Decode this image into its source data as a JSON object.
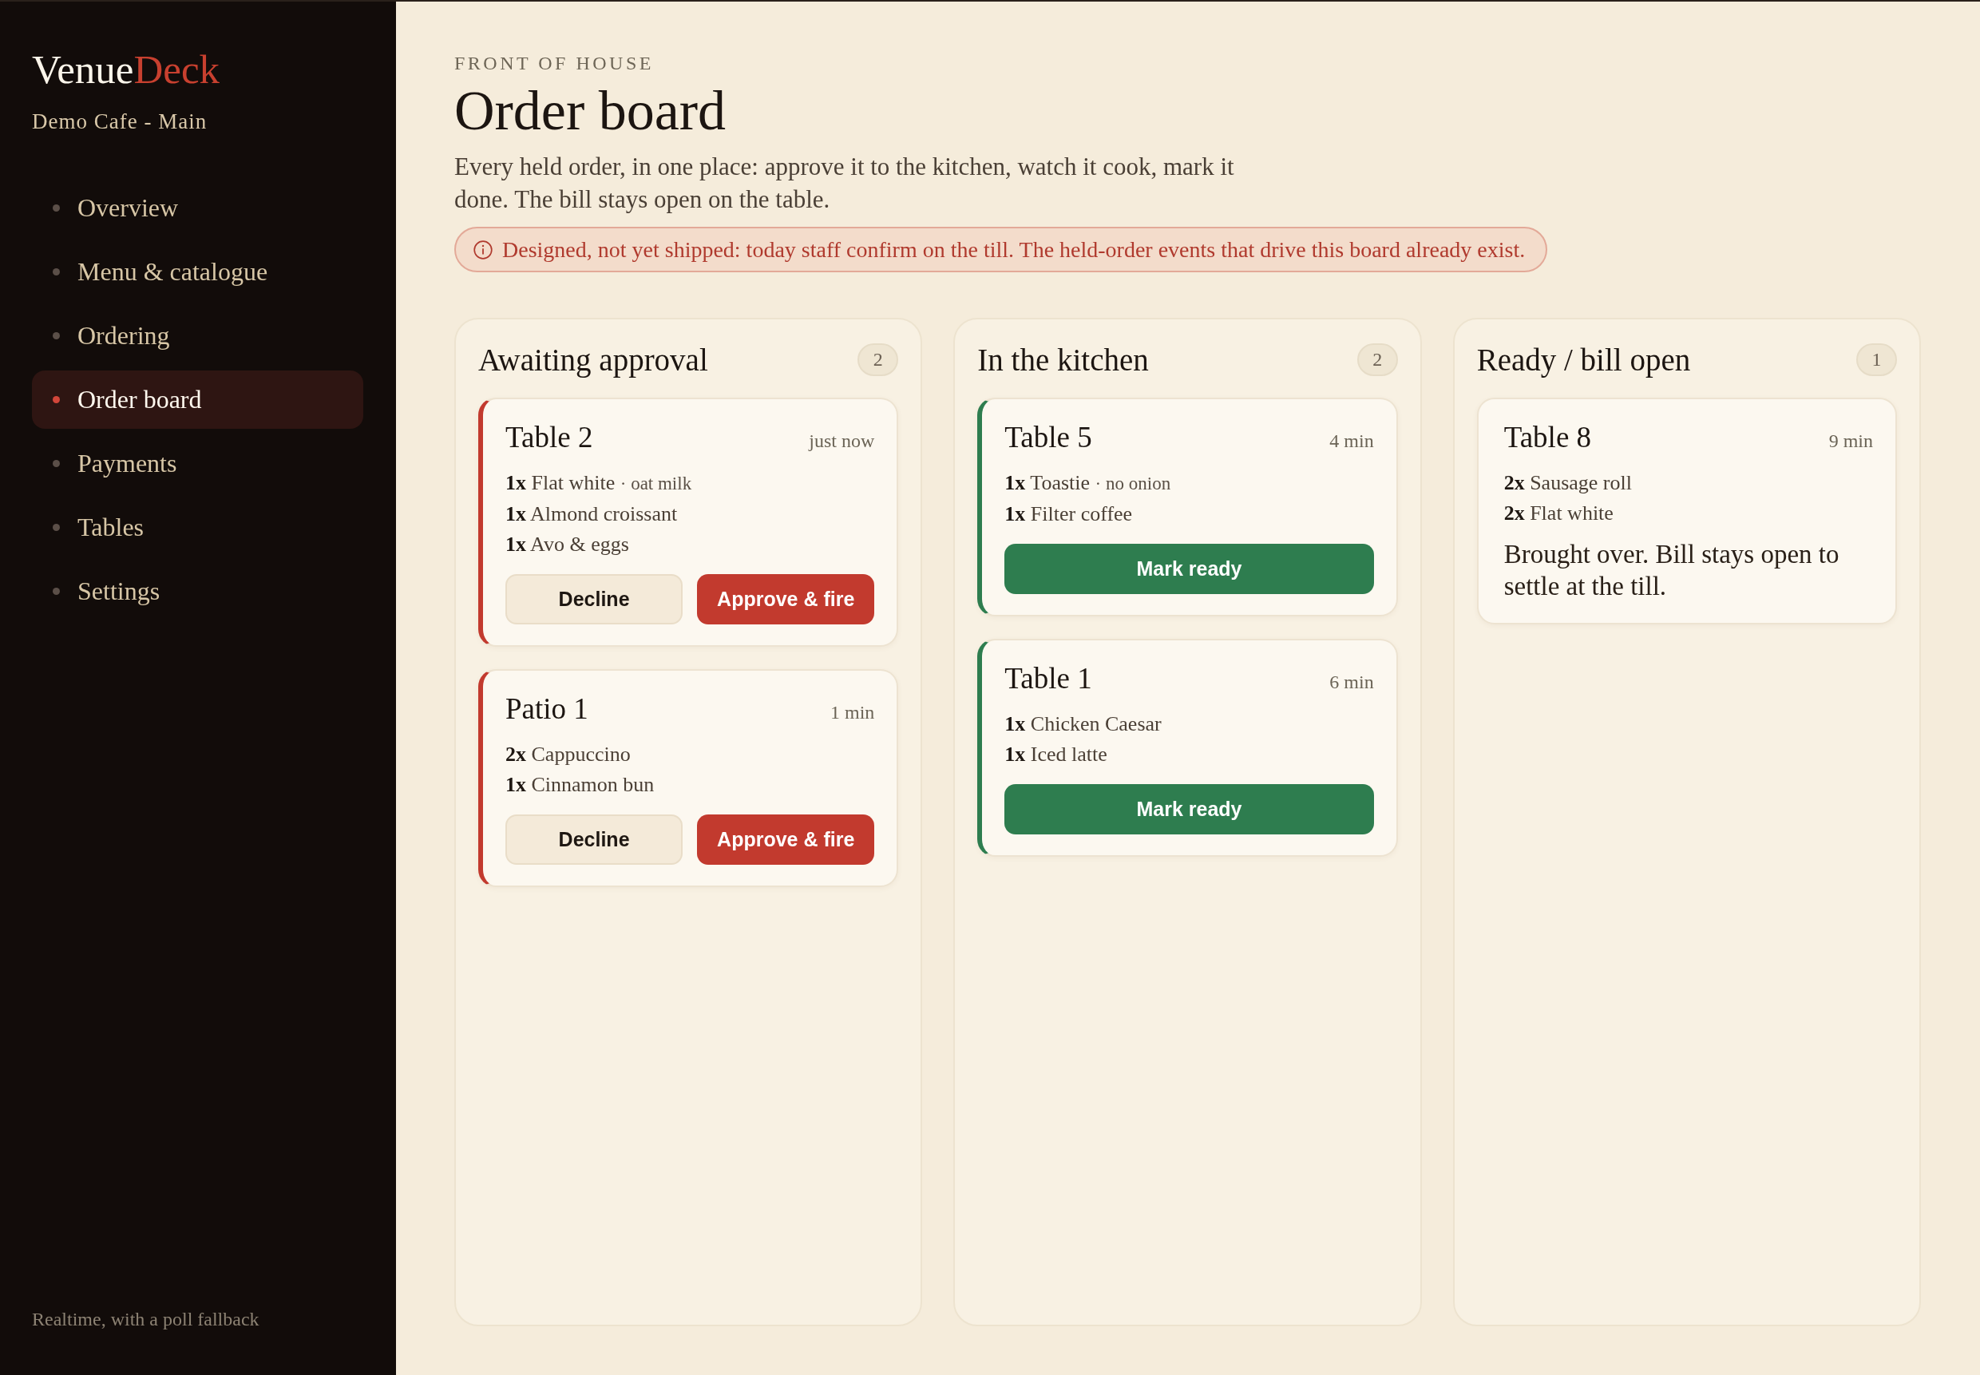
{
  "sidebar": {
    "brand": {
      "first": "Venue",
      "second": "Deck"
    },
    "venue": "Demo Cafe - Main",
    "nav": [
      {
        "label": "Overview",
        "selected": false
      },
      {
        "label": "Menu & catalogue",
        "selected": false
      },
      {
        "label": "Ordering",
        "selected": false
      },
      {
        "label": "Order board",
        "selected": true
      },
      {
        "label": "Payments",
        "selected": false
      },
      {
        "label": "Tables",
        "selected": false
      },
      {
        "label": "Settings",
        "selected": false
      }
    ],
    "footer": "Realtime, with a poll fallback"
  },
  "header": {
    "eyebrow": "FRONT OF HOUSE",
    "title": "Order board",
    "description": "Every held order, in one place: approve it to the kitchen, watch it cook, mark it done. The bill stays open on the table.",
    "notice": "Designed, not yet shipped: today staff confirm on the till. The held-order events that drive this board already exist."
  },
  "columns": [
    {
      "kind": "approval",
      "title": "Awaiting approval",
      "count": "2",
      "cards": [
        {
          "title": "Table 2",
          "time": "just now",
          "items": [
            {
              "qty": "1x",
              "name": "Flat white",
              "note": "· oat milk"
            },
            {
              "qty": "1x",
              "name": "Almond croissant"
            },
            {
              "qty": "1x",
              "name": "Avo & eggs"
            }
          ],
          "actions": [
            {
              "kind": "decline",
              "label": "Decline"
            },
            {
              "kind": "approve",
              "label": "Approve & fire"
            }
          ]
        },
        {
          "title": "Patio 1",
          "time": "1 min",
          "items": [
            {
              "qty": "2x",
              "name": "Cappuccino"
            },
            {
              "qty": "1x",
              "name": "Cinnamon bun"
            }
          ],
          "actions": [
            {
              "kind": "decline",
              "label": "Decline"
            },
            {
              "kind": "approve",
              "label": "Approve & fire"
            }
          ]
        }
      ]
    },
    {
      "kind": "kitchen",
      "title": "In the kitchen",
      "count": "2",
      "cards": [
        {
          "title": "Table 5",
          "time": "4 min",
          "items": [
            {
              "qty": "1x",
              "name": "Toastie",
              "note": "· no onion"
            },
            {
              "qty": "1x",
              "name": "Filter coffee"
            }
          ],
          "actions": [
            {
              "kind": "ready",
              "label": "Mark ready"
            }
          ]
        },
        {
          "title": "Table 1",
          "time": "6 min",
          "items": [
            {
              "qty": "1x",
              "name": "Chicken Caesar"
            },
            {
              "qty": "1x",
              "name": "Iced latte"
            }
          ],
          "actions": [
            {
              "kind": "ready",
              "label": "Mark ready"
            }
          ]
        }
      ]
    },
    {
      "kind": "ready",
      "title": "Ready / bill open",
      "count": "1",
      "cards": [
        {
          "title": "Table 8",
          "time": "9 min",
          "items": [
            {
              "qty": "2x",
              "name": "Sausage roll"
            },
            {
              "qty": "2x",
              "name": "Flat white"
            }
          ],
          "note": "Brought over. Bill stays open to settle at the till."
        }
      ]
    }
  ]
}
